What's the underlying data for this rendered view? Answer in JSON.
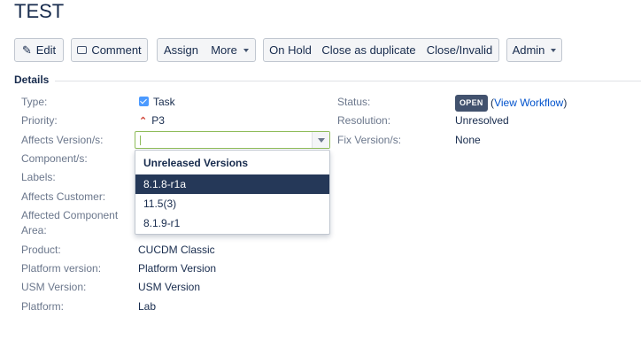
{
  "issue": {
    "title": "TEST"
  },
  "toolbar": {
    "edit": "Edit",
    "comment": "Comment",
    "assign": "Assign",
    "more": "More",
    "on_hold": "On Hold",
    "close_duplicate": "Close as duplicate",
    "close_invalid": "Close/Invalid",
    "admin": "Admin"
  },
  "details": {
    "heading": "Details",
    "left": [
      {
        "label": "Type:",
        "value": "Task",
        "icon": "checkbox-icon"
      },
      {
        "label": "Priority:",
        "value": "P3",
        "icon": "priority-up-icon"
      },
      {
        "label": "Affects Version/s:",
        "value": ""
      },
      {
        "label": "Component/s:",
        "value": ""
      },
      {
        "label": "Labels:",
        "value": ""
      },
      {
        "label": "Affects Customer:",
        "value": ""
      },
      {
        "label": "Affected Component Area:",
        "value": ""
      },
      {
        "label": "Product:",
        "value": "CUCDM Classic"
      },
      {
        "label": "Platform version:",
        "value": "Platform Version"
      },
      {
        "label": "USM Version:",
        "value": "USM Version"
      },
      {
        "label": "Platform:",
        "value": "Lab"
      }
    ],
    "right": {
      "status_label": "Status:",
      "status_badge": "OPEN",
      "view_workflow": "View Workflow",
      "resolution_label": "Resolution:",
      "resolution_value": "Unresolved",
      "fix_version_label": "Fix Version/s:",
      "fix_version_value": "None"
    }
  },
  "affects_version_dropdown": {
    "input_value": "",
    "group_header": "Unreleased Versions",
    "options": [
      {
        "label": "8.1.8-r1a",
        "selected": true
      },
      {
        "label": "11.5(3)",
        "selected": false
      },
      {
        "label": "8.1.9-r1",
        "selected": false
      }
    ]
  },
  "colors": {
    "accent_blue": "#0052cc",
    "selected_item_bg": "#253858",
    "status_lozenge": "#42526e",
    "priority_red": "#d04437",
    "input_focus_border": "#8fbc5a"
  }
}
